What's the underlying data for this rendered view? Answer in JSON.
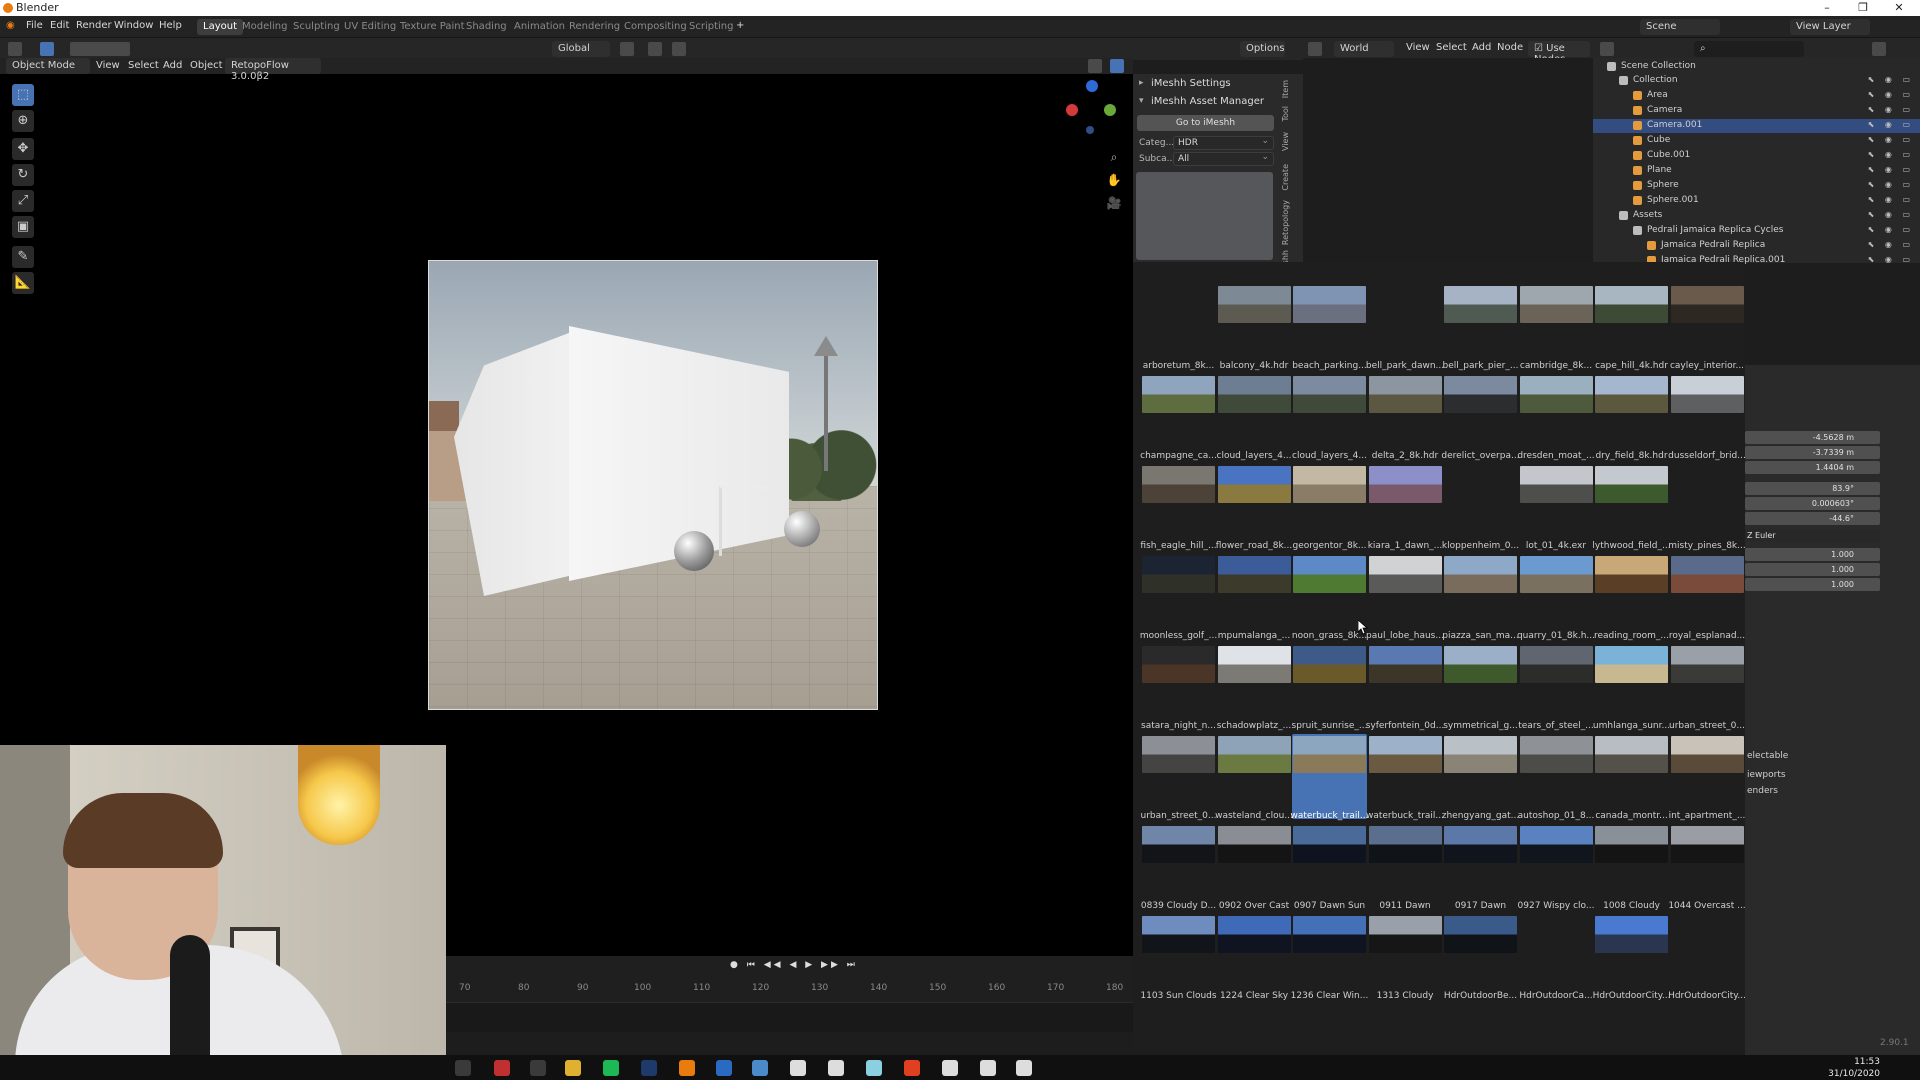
{
  "window": {
    "title": "Blender",
    "minimize": "–",
    "maximize": "❐",
    "close": "✕"
  },
  "menubar": {
    "menus": [
      "File",
      "Edit",
      "Render",
      "Window",
      "Help"
    ],
    "workspaces": [
      "Layout",
      "Modeling",
      "Sculpting",
      "UV Editing",
      "Texture Paint",
      "Shading",
      "Animation",
      "Rendering",
      "Compositing",
      "Scripting"
    ],
    "active_workspace": "Layout",
    "add_tab": "+",
    "scene": "Scene",
    "view_layer": "View Layer"
  },
  "viewport_header": {
    "mode": "Object Mode",
    "menus": [
      "View",
      "Select",
      "Add",
      "Object"
    ],
    "addon": "RetopoFlow 3.0.0β2",
    "transform_orientation": "Global",
    "options": "Options"
  },
  "node_header": {
    "world": "World",
    "menus": [
      "View",
      "Select",
      "Add",
      "Node"
    ],
    "use_nodes": "Use Nodes"
  },
  "imeshh": {
    "settings_label": "iMeshh Settings",
    "asset_manager_label": "iMeshh Asset Manager",
    "goto_button": "Go to iMeshh",
    "category_label": "Categ...",
    "category_value": "HDR",
    "subcategory_label": "Subca...",
    "subcategory_value": "All"
  },
  "side_tabs": [
    "Item",
    "Tool",
    "View",
    "Create",
    "Retopology",
    "iMeshh"
  ],
  "outliner": {
    "root": "Scene Collection",
    "rows": [
      {
        "name": "Collection",
        "indent": 1,
        "icon": "collection-icon",
        "color": "#bcbcbc"
      },
      {
        "name": "Area",
        "indent": 2,
        "icon": "light-icon",
        "color": "#e39b3d"
      },
      {
        "name": "Camera",
        "indent": 2,
        "icon": "camera-icon",
        "color": "#e39b3d"
      },
      {
        "name": "Camera.001",
        "indent": 2,
        "icon": "camera-icon",
        "color": "#e39b3d",
        "selected": true
      },
      {
        "name": "Cube",
        "indent": 2,
        "icon": "mesh-icon",
        "color": "#e39b3d"
      },
      {
        "name": "Cube.001",
        "indent": 2,
        "icon": "mesh-icon",
        "color": "#e39b3d"
      },
      {
        "name": "Plane",
        "indent": 2,
        "icon": "mesh-icon",
        "color": "#e39b3d"
      },
      {
        "name": "Sphere",
        "indent": 2,
        "icon": "mesh-icon",
        "color": "#e39b3d"
      },
      {
        "name": "Sphere.001",
        "indent": 2,
        "icon": "mesh-icon",
        "color": "#e39b3d"
      },
      {
        "name": "Assets",
        "indent": 1,
        "icon": "collection-icon",
        "color": "#bcbcbc"
      },
      {
        "name": "Pedrali Jamaica Replica Cycles",
        "indent": 2,
        "icon": "collection-icon",
        "color": "#bcbcbc"
      },
      {
        "name": "Jamaica Pedrali Replica",
        "indent": 3,
        "icon": "mesh-icon",
        "color": "#e39b3d"
      },
      {
        "name": "Jamaica Pedrali Replica.001",
        "indent": 3,
        "icon": "mesh-icon",
        "color": "#e39b3d"
      }
    ]
  },
  "properties": {
    "location": [
      "-4.5628 m",
      "-3.7339 m",
      "1.4404 m"
    ],
    "rotation": [
      "83.9°",
      "0.000603°",
      "-44.6°"
    ],
    "rotation_mode": "Z Euler",
    "scale": [
      "1.000",
      "1.000",
      "1.000"
    ],
    "labels": [
      "electable",
      "iewports",
      "enders"
    ]
  },
  "hdri_grid": [
    {
      "label": "arboretum_8k...",
      "c1": "#1e1e1e",
      "c2": "#1e1e1e"
    },
    {
      "label": "balcony_4k.hdr",
      "c1": "#7d8a96",
      "c2": "#5d5a52"
    },
    {
      "label": "beach_parking...",
      "c1": "#7f93b3",
      "c2": "#6b7080"
    },
    {
      "label": "bell_park_dawn...",
      "c1": "#1e1e1e",
      "c2": "#1e1e1e"
    },
    {
      "label": "bell_park_pier_...",
      "c1": "#a6b3c4",
      "c2": "#4f5a52"
    },
    {
      "label": "cambridge_8k...",
      "c1": "#9ea7ad",
      "c2": "#6c6358"
    },
    {
      "label": "cape_hill_4k.hdr",
      "c1": "#a8b6c2",
      "c2": "#3d4a35"
    },
    {
      "label": "cayley_interior...",
      "c1": "#6a5a4b",
      "c2": "#2e2823"
    },
    {
      "label": "champagne_ca...",
      "c1": "#8fa4bd",
      "c2": "#5d6d3f"
    },
    {
      "label": "cloud_layers_4...",
      "c1": "#6e7e92",
      "c2": "#3f4a3a"
    },
    {
      "label": "cloud_layers_4...",
      "c1": "#7c8ba0",
      "c2": "#3f4a3a"
    },
    {
      "label": "delta_2_8k.hdr",
      "c1": "#8b96a1",
      "c2": "#5b5740"
    },
    {
      "label": "derelict_overpa...",
      "c1": "#7c8aa0",
      "c2": "#2b2d2f"
    },
    {
      "label": "dresden_moat_...",
      "c1": "#9ab0bf",
      "c2": "#4d5a3c"
    },
    {
      "label": "dry_field_8k.hdr",
      "c1": "#a4b7cf",
      "c2": "#5b583e"
    },
    {
      "label": "dusseldorf_brid...",
      "c1": "#c9cfd6",
      "c2": "#5d5f60"
    },
    {
      "label": "fish_eagle_hill_...",
      "c1": "#7a7670",
      "c2": "#4d4238"
    },
    {
      "label": "flower_road_8k...",
      "c1": "#4a74c2",
      "c2": "#8a7a40"
    },
    {
      "label": "georgentor_8k...",
      "c1": "#c2b8a3",
      "c2": "#8a7c66"
    },
    {
      "label": "kiara_1_dawn_...",
      "c1": "#8c8fc8",
      "c2": "#7a5a6a"
    },
    {
      "label": "kloppenheim_0...",
      "c1": "#1e1e1e",
      "c2": "#1e1e1e"
    },
    {
      "label": "lot_01_4k.exr",
      "c1": "#c3c7cc",
      "c2": "#4e4f4c"
    },
    {
      "label": "lythwood_field_...",
      "c1": "#c3c9cf",
      "c2": "#3d5a2e"
    },
    {
      "label": "misty_pines_8k...",
      "c1": "#1e1e1e",
      "c2": "#1e1e1e"
    },
    {
      "label": "moonless_golf_...",
      "c1": "#1c2333",
      "c2": "#2f3027"
    },
    {
      "label": "mpumalanga_...",
      "c1": "#3b5c98",
      "c2": "#3c3a2a"
    },
    {
      "label": "noon_grass_8k...",
      "c1": "#5d89c7",
      "c2": "#4f7a32"
    },
    {
      "label": "paul_lobe_haus...",
      "c1": "#d0d2d4",
      "c2": "#5a5a58"
    },
    {
      "label": "piazza_san_ma...",
      "c1": "#8ea8c8",
      "c2": "#7a6c5c"
    },
    {
      "label": "quarry_01_8k.h...",
      "c1": "#6a9ad0",
      "c2": "#7a7060"
    },
    {
      "label": "reading_room_...",
      "c1": "#c9a878",
      "c2": "#5a3f26"
    },
    {
      "label": "royal_esplanad...",
      "c1": "#5a6a8a",
      "c2": "#7a4a3a"
    },
    {
      "label": "satara_night_n...",
      "c1": "#2a2a2a",
      "c2": "#4a3526"
    },
    {
      "label": "schadowplatz_...",
      "c1": "#dfe3e8",
      "c2": "#7c7a74"
    },
    {
      "label": "spruit_sunrise_...",
      "c1": "#3e5a88",
      "c2": "#6a5a2a"
    },
    {
      "label": "syferfontein_0d...",
      "c1": "#5a78b2",
      "c2": "#3b3628"
    },
    {
      "label": "symmetrical_g...",
      "c1": "#9bb0c8",
      "c2": "#3e5a2c"
    },
    {
      "label": "tears_of_steel_...",
      "c1": "#5f6670",
      "c2": "#2c2c2a"
    },
    {
      "label": "umhlanga_sunr...",
      "c1": "#7ab2d8",
      "c2": "#c8b890"
    },
    {
      "label": "urban_street_0...",
      "c1": "#9aa0a8",
      "c2": "#3a3a38"
    },
    {
      "label": "urban_street_0...",
      "c1": "#8c9096",
      "c2": "#444442"
    },
    {
      "label": "wasteland_clou...",
      "c1": "#8ea3b8",
      "c2": "#6a7a40"
    },
    {
      "label": "waterbuck_trail...",
      "c1": "#8da6bf",
      "c2": "#8a7a5a",
      "selected": true
    },
    {
      "label": "waterbuck_trail...",
      "c1": "#9db2c8",
      "c2": "#6a5a42"
    },
    {
      "label": "zhengyang_gat...",
      "c1": "#b9c0c6",
      "c2": "#8a8476"
    },
    {
      "label": "autoshop_01_8...",
      "c1": "#8e9296",
      "c2": "#4c4c48"
    },
    {
      "label": "canada_montr...",
      "c1": "#b8bdc3",
      "c2": "#54504a"
    },
    {
      "label": "int_apartment_...",
      "c1": "#c8c2b8",
      "c2": "#5a4a3a"
    },
    {
      "label": "0839 Cloudy D...",
      "c1": "#6f86a8",
      "c2": "#121418"
    },
    {
      "label": "0902 Over Cast",
      "c1": "#8a8e94",
      "c2": "#141414"
    },
    {
      "label": "0907 Dawn Sun",
      "c1": "#4a6a9a",
      "c2": "#0f1320"
    },
    {
      "label": "0911 Dawn",
      "c1": "#5a6e8e",
      "c2": "#101318"
    },
    {
      "label": "0917 Dawn",
      "c1": "#5c78a8",
      "c2": "#10141c"
    },
    {
      "label": "0927 Wispy clo...",
      "c1": "#5a82c0",
      "c2": "#11151e"
    },
    {
      "label": "1008 Cloudy",
      "c1": "#8a9098",
      "c2": "#141414"
    },
    {
      "label": "1044 Overcast ...",
      "c1": "#9a9ea4",
      "c2": "#151515"
    },
    {
      "label": "1103 Sun Clouds",
      "c1": "#6e8cbe",
      "c2": "#111419"
    },
    {
      "label": "1224 Clear Sky",
      "c1": "#3f6ab8",
      "c2": "#0f1420"
    },
    {
      "label": "1236 Clear Win...",
      "c1": "#4470b8",
      "c2": "#0f1420"
    },
    {
      "label": "1313 Cloudy",
      "c1": "#9aa0aa",
      "c2": "#161616"
    },
    {
      "label": "HdrOutdoorBe...",
      "c1": "#3a5a8a",
      "c2": "#101418"
    },
    {
      "label": "HdrOutdoorCa...",
      "c1": "#1e1e1e",
      "c2": "#1e1e1e"
    },
    {
      "label": "HdrOutdoorCity...",
      "c1": "#4a7ad0",
      "c2": "#2a3550"
    },
    {
      "label": "HdrOutdoorCity...",
      "c1": "#1e1e1e",
      "c2": "#1e1e1e"
    }
  ],
  "timeline": {
    "ticks": [
      "70",
      "80",
      "90",
      "100",
      "110",
      "120",
      "130",
      "140",
      "150",
      "160",
      "170",
      "180"
    ],
    "controls": [
      "●",
      "⏮",
      "◀◀",
      "◀",
      "▶",
      "▶▶",
      "⏭"
    ]
  },
  "taskbar": {
    "time": "11:53",
    "date": "31/10/2020",
    "icons": [
      {
        "name": "start-icon",
        "color": "#3a3a3a"
      },
      {
        "name": "app-icon",
        "color": "#c03030"
      },
      {
        "name": "app-icon",
        "color": "#3a3a3a"
      },
      {
        "name": "chrome-icon",
        "color": "#e0b030"
      },
      {
        "name": "spotify-icon",
        "color": "#1db954"
      },
      {
        "name": "photoshop-icon",
        "color": "#1d3a6a"
      },
      {
        "name": "blender-icon",
        "color": "#e87d0d"
      },
      {
        "name": "app-icon",
        "color": "#2a6ac0"
      },
      {
        "name": "app-icon",
        "color": "#4a8ac8"
      },
      {
        "name": "app-icon",
        "color": "#dddddd"
      },
      {
        "name": "app-icon",
        "color": "#dddddd"
      },
      {
        "name": "app-icon",
        "color": "#8ad0e0"
      },
      {
        "name": "app-icon",
        "color": "#e04020"
      },
      {
        "name": "app-icon",
        "color": "#dddddd"
      },
      {
        "name": "app-icon",
        "color": "#dddddd"
      },
      {
        "name": "app-icon",
        "color": "#dddddd"
      }
    ]
  },
  "version": "2.90.1"
}
